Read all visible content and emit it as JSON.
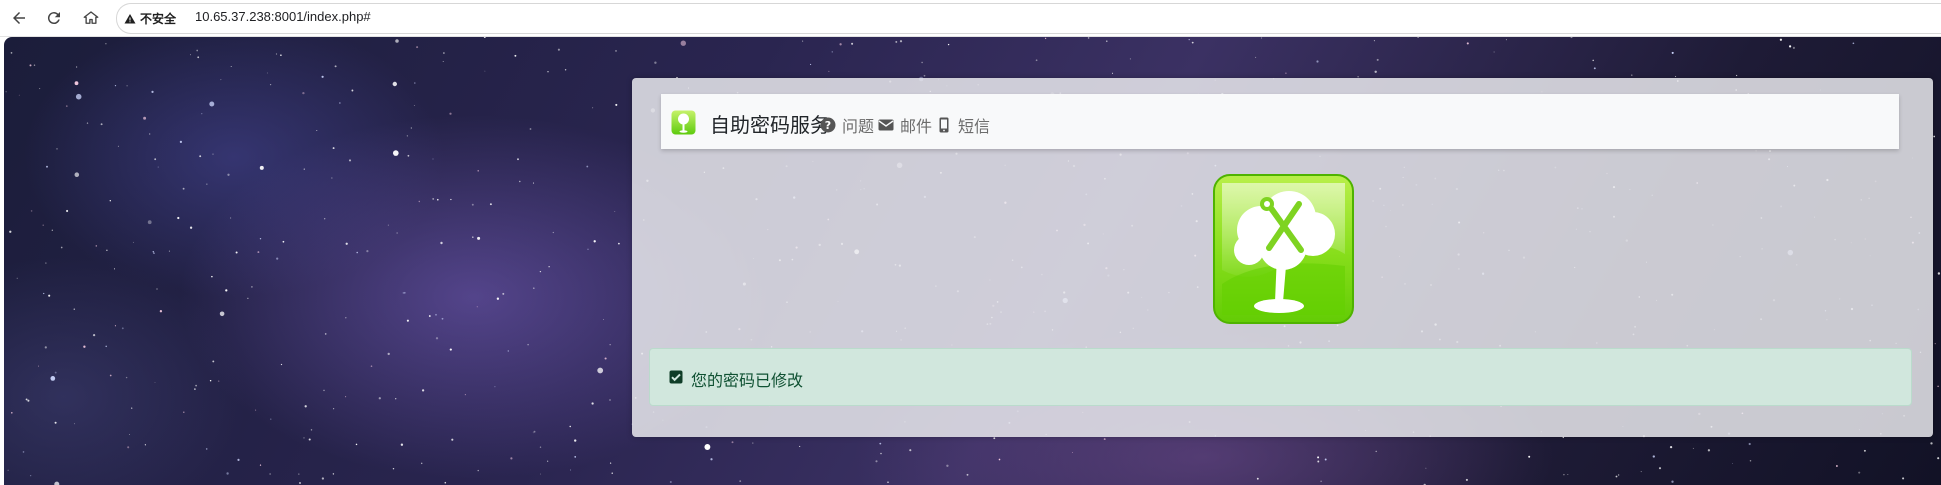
{
  "browser": {
    "security_label": "不安全",
    "url": "10.65.37.238:8001/index.php#",
    "icons": [
      "back-icon",
      "reload-icon",
      "home-icon",
      "warning-icon"
    ]
  },
  "navbar": {
    "brand": "自助密码服务",
    "links": [
      {
        "label": "问题",
        "icon": "question-circle-icon"
      },
      {
        "label": "邮件",
        "icon": "envelope-icon"
      },
      {
        "label": "短信",
        "icon": "mobile-phone-icon"
      }
    ]
  },
  "alert": {
    "message": "您的密码已修改",
    "icon": "check-square-icon",
    "color": "#d1e7dd"
  },
  "colors": {
    "logo_green": "#7ed321",
    "panel": "#e8e8ec",
    "navbar": "#f8f9fa"
  }
}
